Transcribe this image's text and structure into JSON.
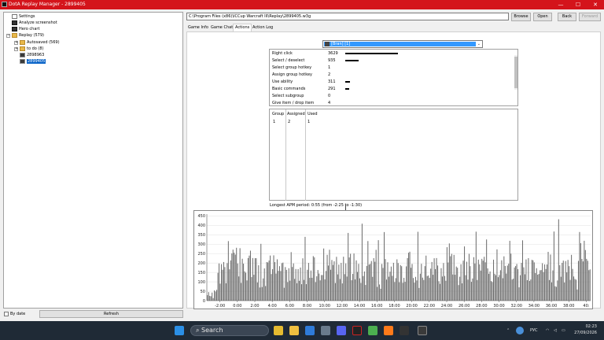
{
  "window": {
    "title": "DotA Replay Manager - 2899405",
    "controls": {
      "minimize": "—",
      "maximize": "☐",
      "close": "✕"
    }
  },
  "tree": [
    {
      "label": "Settings",
      "icon": "settings-icon"
    },
    {
      "label": "Analyze screenshot",
      "icon": "screenshot-icon"
    },
    {
      "label": "Hero chart",
      "icon": "hero-chart-icon"
    },
    {
      "label": "Replay (579)",
      "icon": "folder-icon"
    },
    {
      "label": "Autosaved (569)",
      "icon": "folder-icon"
    },
    {
      "label": "to do (8)",
      "icon": "folder-icon"
    },
    {
      "label": "2898963",
      "icon": "replay-icon"
    },
    {
      "label": "2899405",
      "icon": "replay-icon",
      "selected": true
    }
  ],
  "bottom_left": {
    "by_date_label": "By date",
    "refresh_label": "Refresh"
  },
  "path": "C:\\Program Files (x86)\\ICCup Warcraft III\\Replay\\2899405.w3g",
  "buttons": {
    "browse": "Browse",
    "open": "Open",
    "back": "Back",
    "forward": "Forward"
  },
  "tabs": [
    "Game Info",
    "Game Chat",
    "Actions",
    "Action Log"
  ],
  "active_tab": "Actions",
  "player_select": "[Bran] [1]",
  "actions": [
    {
      "name": "Right click",
      "value": "3629",
      "level": 1.0
    },
    {
      "name": "Select / deselect",
      "value": "935",
      "level": 0.26
    },
    {
      "name": "Select group hotkey",
      "value": "1",
      "level": 0
    },
    {
      "name": "Assign group hotkey",
      "value": "2",
      "level": 0
    },
    {
      "name": "Use ability",
      "value": "311",
      "level": 0.086
    },
    {
      "name": "Basic commands",
      "value": "291",
      "level": 0.08
    },
    {
      "name": "Select subgroup",
      "value": "0",
      "level": 0
    },
    {
      "name": "Give item / drop item",
      "value": "4",
      "level": 0
    }
  ],
  "groups_table": {
    "headers": [
      "Group",
      "Assigned",
      "Used"
    ],
    "rows": [
      [
        "1",
        "2",
        "1"
      ]
    ]
  },
  "apm_period": "Longest APM period: 0:55 (from -2:25 to -1:30)",
  "chart_data": {
    "type": "bar",
    "y_ticks": [
      "0",
      "50",
      "100",
      "150",
      "200",
      "250",
      "300",
      "350",
      "400",
      "450"
    ],
    "ylim": [
      0,
      460
    ],
    "x_ticks": [
      "-2:00",
      "0:00",
      "2:00",
      "4:00",
      "6:00",
      "8:00",
      "10:00",
      "12:00",
      "14:00",
      "16:00",
      "18:00",
      "20:00",
      "22:00",
      "24:00",
      "26:00",
      "28:00",
      "30:00",
      "32:00",
      "34:00",
      "36:00",
      "38:00",
      "40:"
    ],
    "x_range_minutes": [
      -3.5,
      40.5
    ],
    "grid": true,
    "seed": 2899405,
    "note_values": "approximate per-interval APM bars, mostly between 100 and 300 with peaks near 450"
  },
  "taskbar": {
    "search_label": "Search",
    "lang": "РУС",
    "time": "02:23",
    "date": "27/09/2026"
  }
}
